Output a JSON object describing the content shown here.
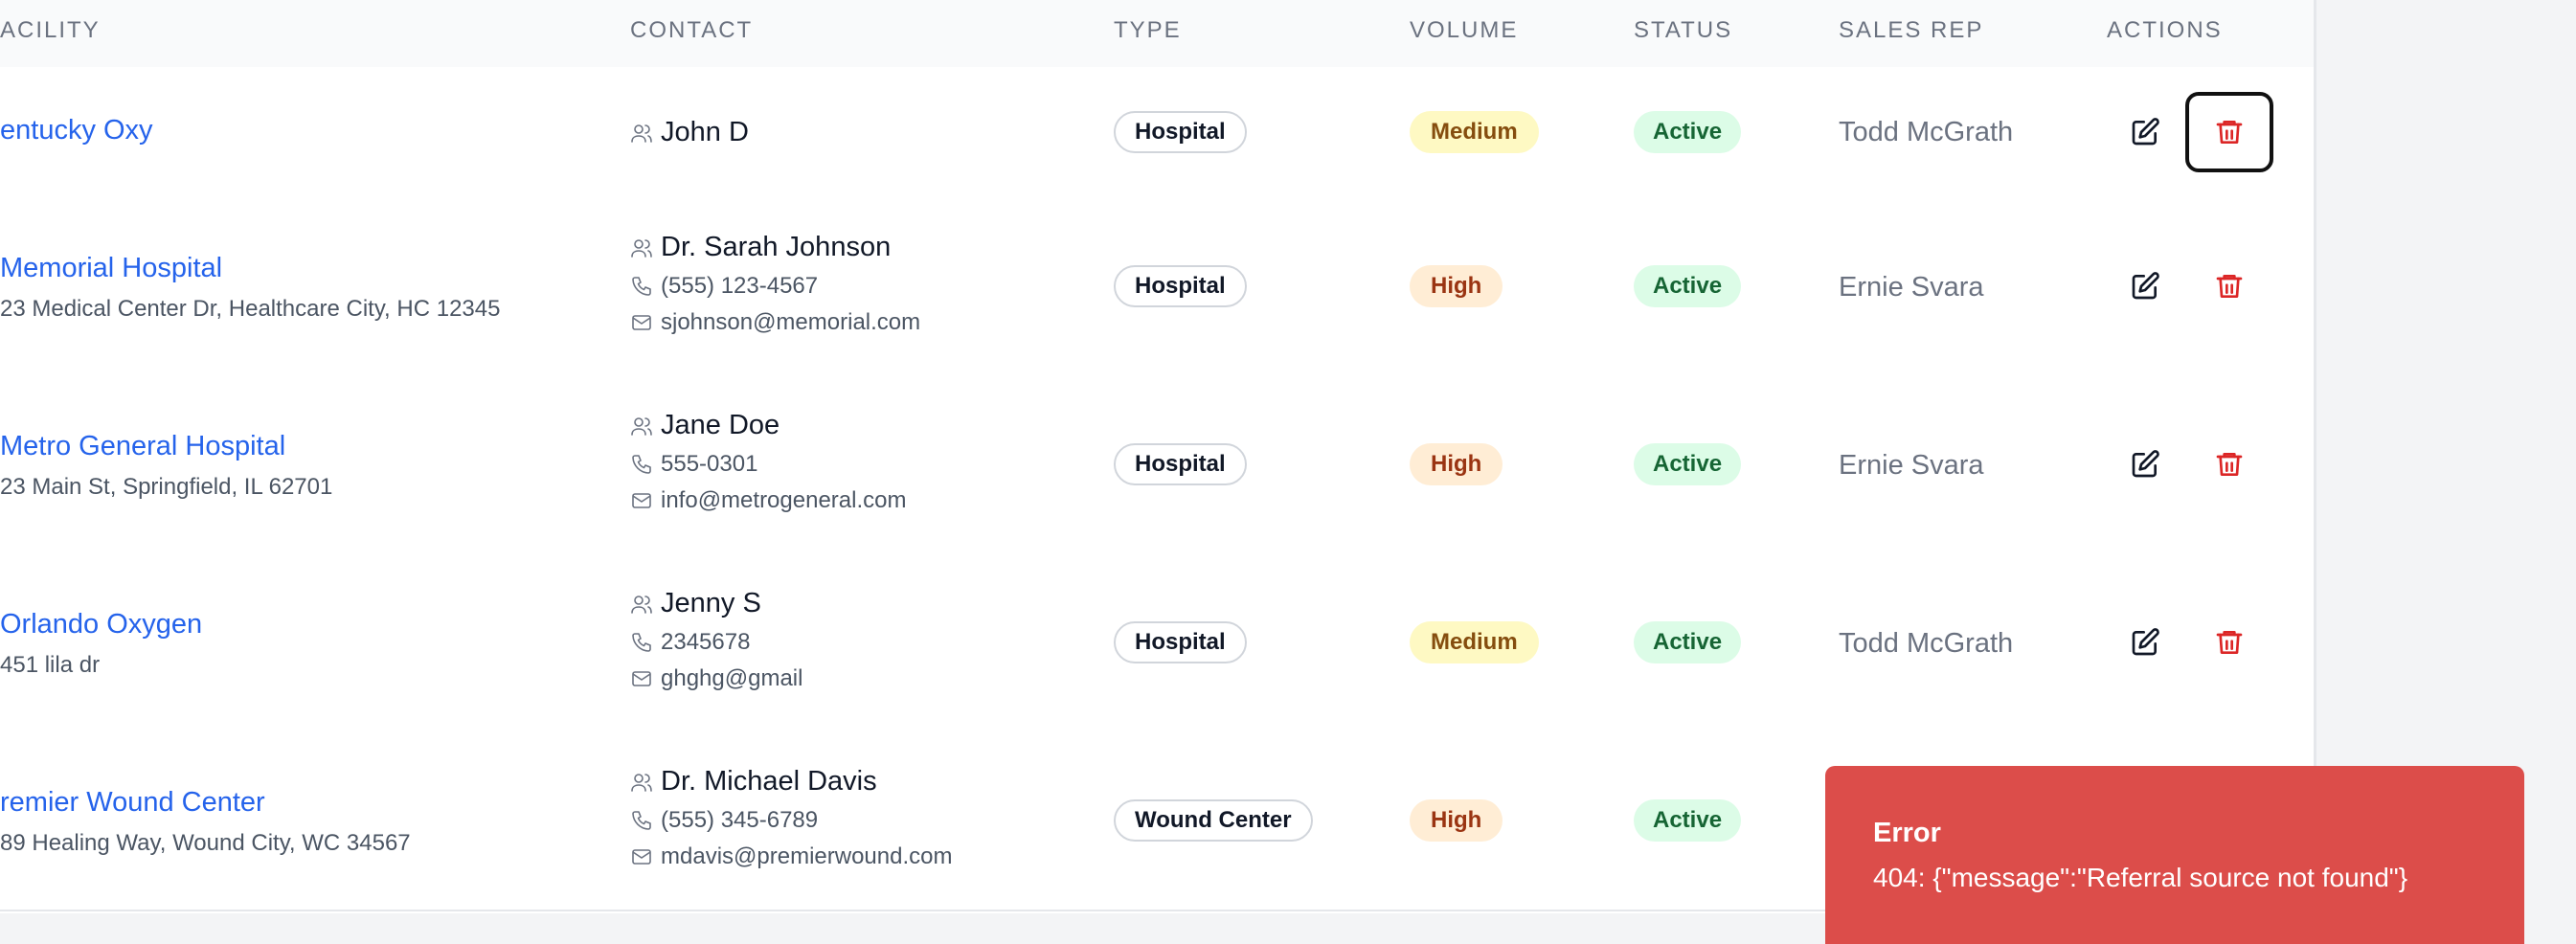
{
  "table": {
    "headers": {
      "facility": "ACILITY",
      "contact": "CONTACT",
      "type": "TYPE",
      "volume": "VOLUME",
      "status": "STATUS",
      "sales_rep": "SALES REP",
      "actions": "ACTIONS"
    },
    "rows": [
      {
        "facility": "entucky Oxy",
        "address": "",
        "contact_name": "John D",
        "phone": "",
        "email": "",
        "type": "Hospital",
        "volume": "Medium",
        "status": "Active",
        "sales_rep": "Todd McGrath"
      },
      {
        "facility": "Memorial Hospital",
        "address": "23 Medical Center Dr, Healthcare City, HC 12345",
        "contact_name": "Dr. Sarah Johnson",
        "phone": "(555) 123-4567",
        "email": "sjohnson@memorial.com",
        "type": "Hospital",
        "volume": "High",
        "status": "Active",
        "sales_rep": "Ernie Svara"
      },
      {
        "facility": "Metro General Hospital",
        "address": "23 Main St, Springfield, IL 62701",
        "contact_name": "Jane Doe",
        "phone": "555-0301",
        "email": "info@metrogeneral.com",
        "type": "Hospital",
        "volume": "High",
        "status": "Active",
        "sales_rep": "Ernie Svara"
      },
      {
        "facility": "Orlando Oxygen",
        "address": "451 lila dr",
        "contact_name": "Jenny S",
        "phone": "2345678",
        "email": "ghghg@gmail",
        "type": "Hospital",
        "volume": "Medium",
        "status": "Active",
        "sales_rep": "Todd McGrath"
      },
      {
        "facility": "remier Wound Center",
        "address": "89 Healing Way, Wound City, WC 34567",
        "contact_name": "Dr. Michael Davis",
        "phone": "(555) 345-6789",
        "email": "mdavis@premierwound.com",
        "type": "Wound Center",
        "volume": "High",
        "status": "Active",
        "sales_rep": ""
      }
    ]
  },
  "toast": {
    "title": "Error",
    "message": "404: {\"message\":\"Referral source not found\"}"
  },
  "icons": {
    "contact": "user-icon",
    "phone": "phone-icon",
    "email": "mail-icon",
    "edit": "edit-icon",
    "delete": "trash-icon"
  },
  "colors": {
    "link": "#2563eb",
    "delete": "#dc2626",
    "toast_bg": "#dc4d4a",
    "medium_bg": "#fef9c3",
    "high_bg": "#ffedd5",
    "active_bg": "#dcfce7"
  }
}
